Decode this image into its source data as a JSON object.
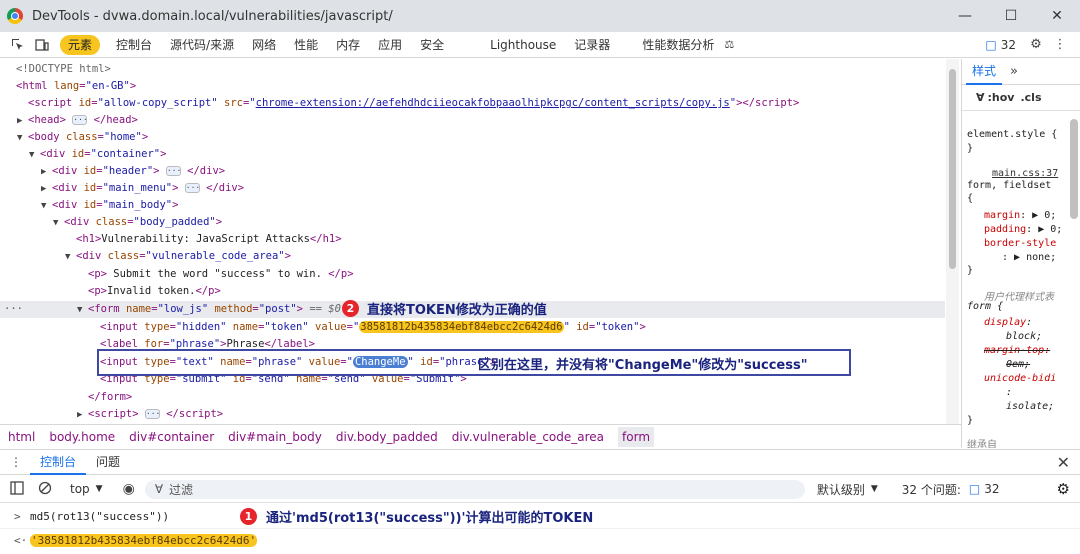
{
  "window": {
    "title": "DevTools - dvwa.domain.local/vulnerabilities/javascript/"
  },
  "tabs": [
    "元素",
    "控制台",
    "源代码/来源",
    "网络",
    "性能",
    "内存",
    "应用",
    "安全",
    "Lighthouse",
    "记录器",
    "性能数据分析"
  ],
  "issues_count": "32",
  "dom": {
    "doctype": "<!DOCTYPE html>",
    "html_lang": "\"en-GB\"",
    "script_id": "\"allow-copy_script\"",
    "script_src": "chrome-extension://aefehdhdciieocakfobpaaolhipkcpgc/content_scripts/copy.js",
    "body_class": "\"home\"",
    "div_container": "\"container\"",
    "div_header": "\"header\"",
    "div_main_menu": "\"main_menu\"",
    "div_main_body": "\"main_body\"",
    "div_body_padded": "\"body_padded\"",
    "h1_text": "Vulnerability: JavaScript Attacks",
    "div_vuln": "\"vulnerable_code_area\"",
    "p1_text": " Submit the word \"success\" to win. ",
    "p2_text": "Invalid token.",
    "form_name": "\"low_js\"",
    "form_method": "\"post\"",
    "form_eq": " == $0",
    "token_value": "38581812b435834ebf84ebcc2c6424d6",
    "token_id": "\"token\"",
    "label_for": "\"phrase\"",
    "label_text": "Phrase",
    "phrase_value": "ChangeMe",
    "phrase_id": "\"phrase\"",
    "submit_id": "\"send\"",
    "submit_name": "\"send\"",
    "submit_value": "\"Submit\""
  },
  "annotations": {
    "a1_num": "1",
    "a1_text": "通过'md5(rot13(\"success\"))'计算出可能的TOKEN",
    "a2_num": "2",
    "a2_text": "直接将TOKEN修改为正确的值",
    "a3_text": "区别在这里，并没有将\"ChangeMe\"修改为\"success\""
  },
  "styles": {
    "tab": "样式",
    "filter_hov": ":hov",
    "filter_cls": ".cls",
    "element_style": "element.style {",
    "source": "main.css:37",
    "selector": "form, fieldset",
    "margin": "margin",
    "margin_val": "0;",
    "padding": "padding",
    "padding_val": "0;",
    "border_style": "border-style",
    "border_val": "none;",
    "ua_header": "用户代理样式表",
    "ua_selector": "form {",
    "display": "display",
    "display_val": "block;",
    "margin_top": "margin-top:",
    "margin_top_val": "0em;",
    "unicode_bidi": "unicode-bidi",
    "unicode_val": "isolate;",
    "inherit": "继承自"
  },
  "breadcrumb": [
    "html",
    "body.home",
    "div#container",
    "div#main_body",
    "div.body_padded",
    "div.vulnerable_code_area",
    "form"
  ],
  "drawer": {
    "tab1": "控制台",
    "tab2": "问题"
  },
  "console_toolbar": {
    "context": "top",
    "filter_placeholder": "过滤",
    "level": "默认级别",
    "issues_label": "32 个问题:",
    "issues_count": "32"
  },
  "console": {
    "input": "md5(rot13(\"success\"))",
    "output": "'38581812b435834ebf84ebcc2c6424d6'"
  }
}
